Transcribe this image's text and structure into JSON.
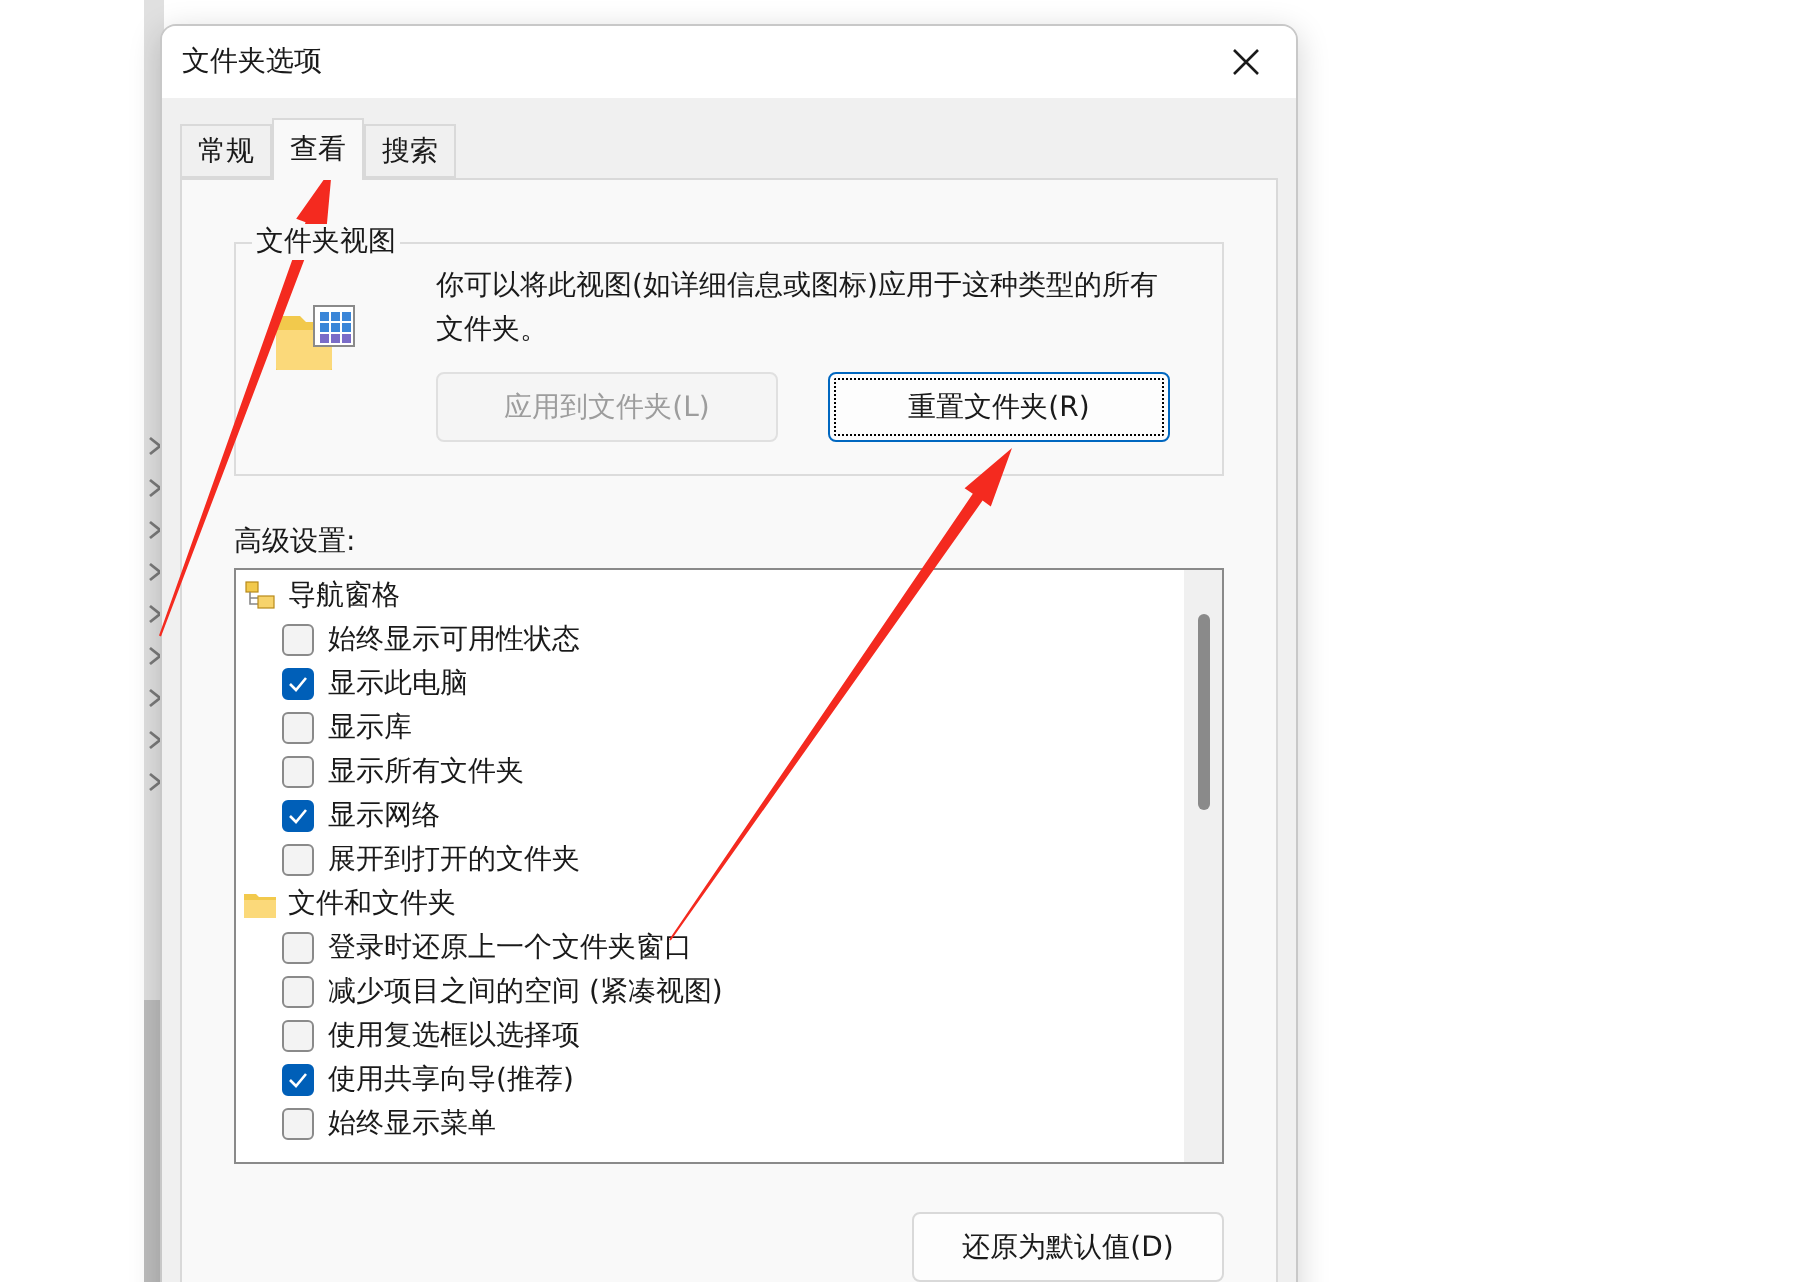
{
  "window": {
    "title": "文件夹选项"
  },
  "tabs": [
    {
      "label": "常规",
      "selected": false
    },
    {
      "label": "查看",
      "selected": true
    },
    {
      "label": "搜索",
      "selected": false
    }
  ],
  "folder_views": {
    "title": "文件夹视图",
    "description": "你可以将此视图(如详细信息或图标)应用于这种类型的所有文件夹。",
    "buttons": [
      {
        "label": "应用到文件夹(L)",
        "disabled": true,
        "focused": false
      },
      {
        "label": "重置文件夹(R)",
        "disabled": false,
        "focused": true
      }
    ]
  },
  "advanced_settings": {
    "label": "高级设置:",
    "tree": [
      {
        "kind": "panes",
        "label": "导航窗格",
        "children": [
          {
            "label": "始终显示可用性状态",
            "checked": false
          },
          {
            "label": "显示此电脑",
            "checked": true
          },
          {
            "label": "显示库",
            "checked": false
          },
          {
            "label": "显示所有文件夹",
            "checked": false
          },
          {
            "label": "显示网络",
            "checked": true
          },
          {
            "label": "展开到打开的文件夹",
            "checked": false
          }
        ]
      },
      {
        "kind": "folder",
        "label": "文件和文件夹",
        "children": [
          {
            "label": "登录时还原上一个文件夹窗口",
            "checked": false
          },
          {
            "label": "减少项目之间的空间 (紧凑视图)",
            "checked": false
          },
          {
            "label": "使用复选框以选择项",
            "checked": false
          },
          {
            "label": "使用共享向导(推荐)",
            "checked": true
          },
          {
            "label": "始终显示菜单",
            "checked": false
          }
        ]
      }
    ]
  },
  "restore_button": {
    "label": "还原为默认值(D)"
  }
}
